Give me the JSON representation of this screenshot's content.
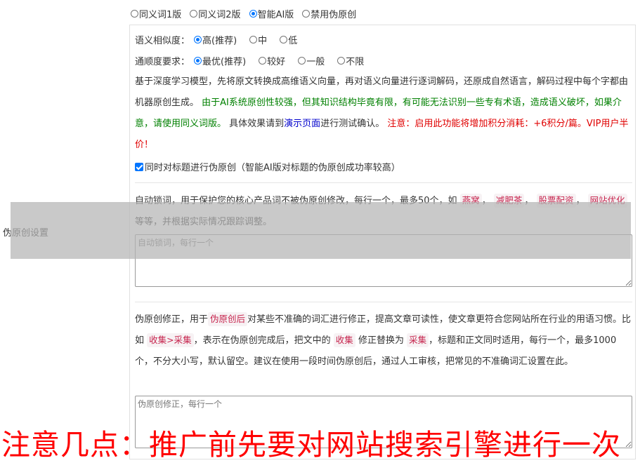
{
  "side_label": "伪原创设置",
  "modes": [
    {
      "label": "同义词1版",
      "checked": false
    },
    {
      "label": "同义词2版",
      "checked": false
    },
    {
      "label": "智能AI版",
      "checked": true
    },
    {
      "label": "禁用伪原创",
      "checked": false
    }
  ],
  "similarity": {
    "label": "语义相似度：",
    "options": [
      {
        "label": "高(推荐)",
        "checked": true
      },
      {
        "label": "中",
        "checked": false
      },
      {
        "label": "低",
        "checked": false
      }
    ]
  },
  "fluency": {
    "label": "通顺度要求：",
    "options": [
      {
        "label": "最优(推荐)",
        "checked": true
      },
      {
        "label": "较好",
        "checked": false
      },
      {
        "label": "一般",
        "checked": false
      },
      {
        "label": "不限",
        "checked": false
      }
    ]
  },
  "description": {
    "part1": "基于深度学习模型，先将原文转换成高维语义向量，再对语义向量进行逐词解码，还原成自然语言，解码过程中每个字都由机器原创生成。",
    "part2_green": "由于AI系统原创性较强，但其知识结构毕竟有限，有可能无法识别一些专有术语，造成语义破坏，如果介意，请使用同义词版。",
    "part3": "具体效果请到",
    "link": "演示页面",
    "part4": "进行测试确认。",
    "part5_red": "注意：启用此功能将增加积分消耗：+6积分/篇。VIP用户半价！"
  },
  "title_checkbox": {
    "label": "同时对标题进行伪原创（智能AI版对标题的伪原创成功率较高）",
    "checked": true
  },
  "lock_words": {
    "text1": "自动锁词，用于保护您的核心产品词不被伪原创修改，每行一个，最多50个，如",
    "examples": [
      "燕窝",
      "减肥茶",
      "股票配资",
      "网站优化"
    ],
    "text2": "等等，并根据实际情况跟踪调整。",
    "placeholder": "自动锁词，每行一个"
  },
  "correction": {
    "text1": "伪原创修正，用于",
    "tag1": "伪原创后",
    "text2": "对某些不准确的词汇进行修正，提高文章可读性，使文章更符合您网站所在行业的用语习惯。比如",
    "tag2": "收集>采集",
    "text3": "，表示在伪原创完成后，把文中的",
    "tag3": "收集",
    "text4": "修正替换为",
    "tag4": "采集",
    "text5": "，标题和正文同时适用，每行一个，最多1000个，不分大小写，默认留空。建议在使用一段时间伪原创后，通过人工审核，把常见的不准确词汇设置在此。",
    "placeholder": "伪原创修正，每行一个"
  },
  "banner": "注意几点：推广前先要对网站搜索引擎进行一次"
}
